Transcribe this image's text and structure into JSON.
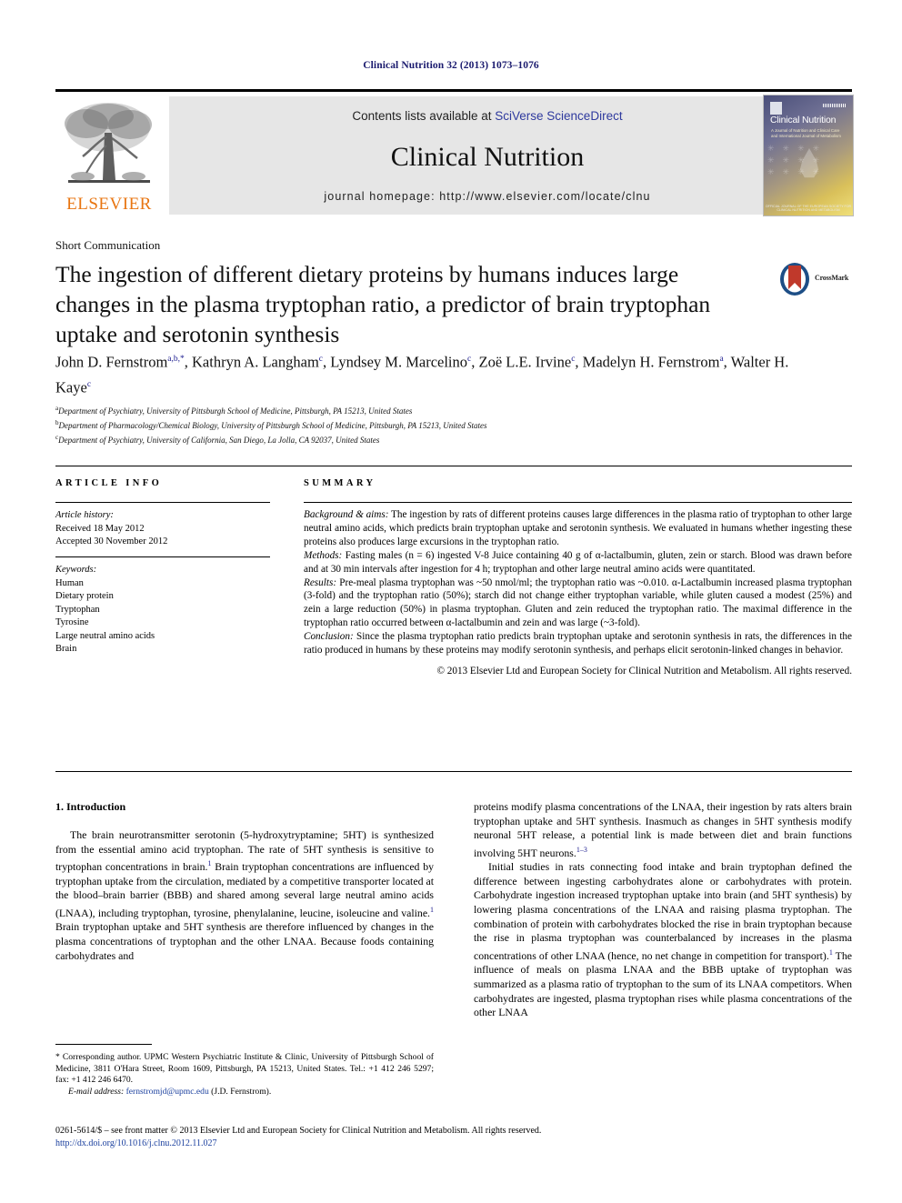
{
  "running_head": "Clinical Nutrition 32 (2013) 1073–1076",
  "masthead": {
    "publisher": "ELSEVIER",
    "contents_prefix": "Contents lists available at ",
    "contents_link": "SciVerse ScienceDirect",
    "journal_title": "Clinical Nutrition",
    "homepage": "journal homepage: http://www.elsevier.com/locate/clnu",
    "cover": {
      "title": "Clinical Nutrition",
      "subtitle": "A Journal of Nutrition and Clinical Care and International Journal of Metabolism",
      "footer": "OFFICIAL JOURNAL OF THE EUROPEAN SOCIETY FOR CLINICAL NUTRITION AND METABOLISM"
    }
  },
  "article": {
    "type": "Short Communication",
    "title": "The ingestion of different dietary proteins by humans induces large changes in the plasma tryptophan ratio, a predictor of brain tryptophan uptake and serotonin synthesis",
    "crossmark_label": "CrossMark",
    "authors_html": "John D. Fernstrom<sup>a,b,</sup><sup>*</sup>, Kathryn A. Langham<sup>c</sup>, Lyndsey M. Marcelino<sup>c</sup>, Zoë L.E. Irvine<sup>c</sup>, Madelyn H. Fernstrom<sup>a</sup>, Walter H. Kaye<sup>c</sup>",
    "affiliations": [
      {
        "marker": "a",
        "text": "Department of Psychiatry, University of Pittsburgh School of Medicine, Pittsburgh, PA 15213, United States"
      },
      {
        "marker": "b",
        "text": "Department of Pharmacology/Chemical Biology, University of Pittsburgh School of Medicine, Pittsburgh, PA 15213, United States"
      },
      {
        "marker": "c",
        "text": "Department of Psychiatry, University of California, San Diego, La Jolla, CA 92037, United States"
      }
    ]
  },
  "info": {
    "heading": "ARTICLE INFO",
    "history_label": "Article history:",
    "received": "Received 18 May 2012",
    "accepted": "Accepted 30 November 2012",
    "keywords_label": "Keywords:",
    "keywords": [
      "Human",
      "Dietary protein",
      "Tryptophan",
      "Tyrosine",
      "Large neutral amino acids",
      "Brain"
    ]
  },
  "summary": {
    "heading": "SUMMARY",
    "background_label": "Background & aims:",
    "background_text": " The ingestion by rats of different proteins causes large differences in the plasma ratio of tryptophan to other large neutral amino acids, which predicts brain tryptophan uptake and serotonin synthesis. We evaluated in humans whether ingesting these proteins also produces large excursions in the tryptophan ratio.",
    "methods_label": "Methods:",
    "methods_text": " Fasting males (n = 6) ingested V-8 Juice containing 40 g of α-lactalbumin, gluten, zein or starch. Blood was drawn before and at 30 min intervals after ingestion for 4 h; tryptophan and other large neutral amino acids were quantitated.",
    "results_label": "Results:",
    "results_text": " Pre-meal plasma tryptophan was ~50 nmol/ml; the tryptophan ratio was ~0.010. α-Lactalbumin increased plasma tryptophan (3-fold) and the tryptophan ratio (50%); starch did not change either tryptophan variable, while gluten caused a modest (25%) and zein a large reduction (50%) in plasma tryptophan. Gluten and zein reduced the tryptophan ratio. The maximal difference in the tryptophan ratio occurred between α-lactalbumin and zein and was large (~3-fold).",
    "conclusion_label": "Conclusion:",
    "conclusion_text": " Since the plasma tryptophan ratio predicts brain tryptophan uptake and serotonin synthesis in rats, the differences in the ratio produced in humans by these proteins may modify serotonin synthesis, and perhaps elicit serotonin-linked changes in behavior.",
    "copyright": "© 2013 Elsevier Ltd and European Society for Clinical Nutrition and Metabolism. All rights reserved."
  },
  "body": {
    "intro_heading": "1. Introduction",
    "left_p1": "The brain neurotransmitter serotonin (5-hydroxytryptamine; 5HT) is synthesized from the essential amino acid tryptophan. The rate of 5HT synthesis is sensitive to tryptophan concentrations in brain.<sup>1</sup> Brain tryptophan concentrations are influenced by tryptophan uptake from the circulation, mediated by a competitive transporter located at the blood–brain barrier (BBB) and shared among several large neutral amino acids (LNAA), including tryptophan, tyrosine, phenylalanine, leucine, isoleucine and valine.<sup>1</sup> Brain tryptophan uptake and 5HT synthesis are therefore influenced by changes in the plasma concentrations of tryptophan and the other LNAA. Because foods containing carbohydrates and",
    "right_p1": "proteins modify plasma concentrations of the LNAA, their ingestion by rats alters brain tryptophan uptake and 5HT synthesis. Inasmuch as changes in 5HT synthesis modify neuronal 5HT release, a potential link is made between diet and brain functions involving 5HT neurons.<sup>1–3</sup>",
    "right_p2": "Initial studies in rats connecting food intake and brain tryptophan defined the difference between ingesting carbohydrates alone or carbohydrates with protein. Carbohydrate ingestion increased tryptophan uptake into brain (and 5HT synthesis) by lowering plasma concentrations of the LNAA and raising plasma tryptophan. The combination of protein with carbohydrates blocked the rise in brain tryptophan because the rise in plasma tryptophan was counterbalanced by increases in the plasma concentrations of other LNAA (hence, no net change in competition for transport).<sup>1</sup> The influence of meals on plasma LNAA and the BBB uptake of tryptophan was summarized as a plasma ratio of tryptophan to the sum of its LNAA competitors. When carbohydrates are ingested, plasma tryptophan rises while plasma concentrations of the other LNAA"
  },
  "footnotes": {
    "corresponding": "* Corresponding author. UPMC Western Psychiatric Institute & Clinic, University of Pittsburgh School of Medicine, 3811 O'Hara Street, Room 1609, Pittsburgh, PA 15213, United States. Tel.: +1 412 246 5297; fax: +1 412 246 6470.",
    "email_label": "E-mail address:",
    "email": "fernstromjd@upmc.edu",
    "email_suffix": " (J.D. Fernstrom)."
  },
  "imprint": {
    "line1": "0261-5614/$ – see front matter © 2013 Elsevier Ltd and European Society for Clinical Nutrition and Metabolism. All rights reserved.",
    "doi": "http://dx.doi.org/10.1016/j.clnu.2012.11.027"
  },
  "colors": {
    "running_head": "#1a1a6e",
    "link": "#1a3f9e",
    "elsevier_orange": "#e87511",
    "band_gray": "#e6e6e6"
  }
}
